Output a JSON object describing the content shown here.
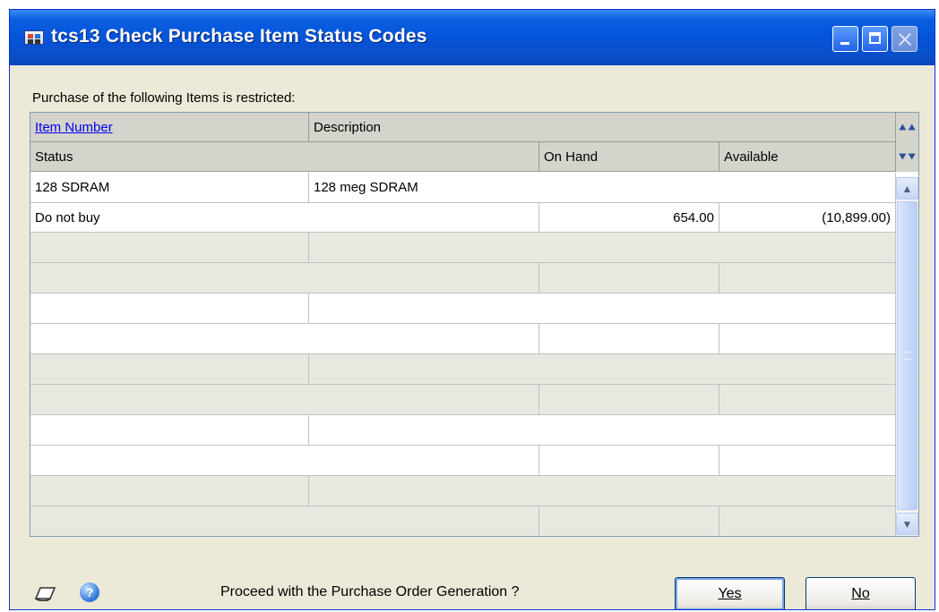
{
  "window": {
    "title": "tcs13 Check Purchase Item Status Codes",
    "icon": "app-window-icon"
  },
  "intro_label": "Purchase of the following Items is restricted:",
  "grid": {
    "header1": {
      "item_number": "Item Number",
      "description": "Description"
    },
    "header2": {
      "status": "Status",
      "on_hand": "On Hand",
      "available": "Available"
    },
    "records": [
      {
        "item_number": "128 SDRAM",
        "description": "128 meg SDRAM",
        "status": "Do not buy",
        "on_hand": "654.00",
        "available": "(10,899.00)"
      }
    ],
    "empty_records": 5
  },
  "footer": {
    "prompt": "Proceed with the Purchase Order Generation ?",
    "yes_label": "Yes",
    "no_label": "No"
  },
  "colors": {
    "titlebar": "#0454d9",
    "window_bg": "#ECE9D8",
    "header_bg": "#d4d4cc",
    "alt_row_bg": "#e8e8e0",
    "link": "#0000ee"
  }
}
